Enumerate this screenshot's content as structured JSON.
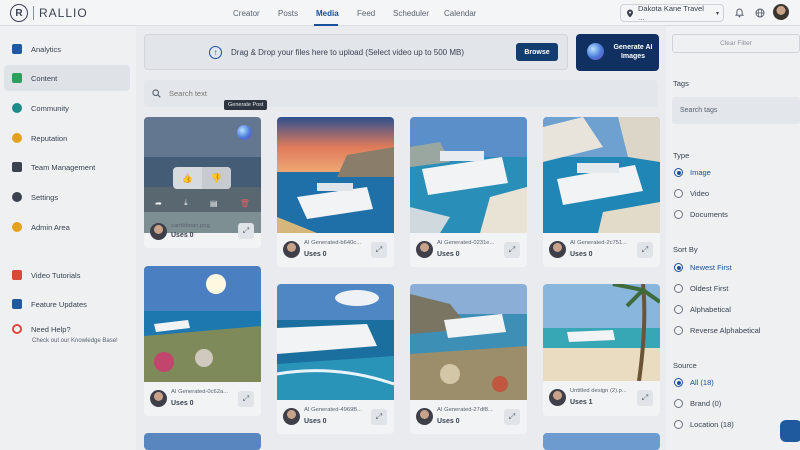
{
  "app": {
    "brand": "RALLIO",
    "brand_mark": "R"
  },
  "nav": {
    "items": [
      "Creator",
      "Posts",
      "Media",
      "Feed",
      "Scheduler",
      "Calendar"
    ],
    "active": "Media"
  },
  "location": {
    "label": "Dakota Kane Travel ..."
  },
  "sidebar": {
    "items": [
      {
        "label": "Analytics",
        "color": "#1f5a9e"
      },
      {
        "label": "Content",
        "color": "#2e9e5b"
      },
      {
        "label": "Community",
        "color": "#1f8a8a"
      },
      {
        "label": "Reputation",
        "color": "#e3a21a"
      },
      {
        "label": "Team Management",
        "color": "#3a4250"
      },
      {
        "label": "Settings",
        "color": "#3a4250"
      },
      {
        "label": "Admin Area",
        "color": "#e3a21a"
      },
      {
        "label": "Video Tutorials",
        "color": "#d9473d"
      },
      {
        "label": "Feature Updates",
        "color": "#1f5a9e"
      },
      {
        "label": "Need Help?",
        "color": "#d9473d"
      }
    ],
    "help_sub": "Check out our Knowledge Base!"
  },
  "upload": {
    "text": "Drag & Drop your files here to upload (Select video up to 500 MB)",
    "browse": "Browse"
  },
  "generate_ai": {
    "label": "Generate AI Images"
  },
  "search": {
    "placeholder": "Search text"
  },
  "tooltip": "Generate Post",
  "cards": [
    {
      "caption": "carribbean.png",
      "uses": "Uses 0"
    },
    {
      "caption": "AI Generated-b640c...",
      "uses": "Uses 0"
    },
    {
      "caption": "AI Generated-0231e...",
      "uses": "Uses 0"
    },
    {
      "caption": "AI Generated-2c751...",
      "uses": "Uses 0"
    },
    {
      "caption": "AI Generated-0c62a...",
      "uses": "Uses 0"
    },
    {
      "caption": "AI Generated-4969B...",
      "uses": "Uses 0"
    },
    {
      "caption": "AI Generated-27df8...",
      "uses": "Uses 0"
    },
    {
      "caption": "Untitled design (2).p...",
      "uses": "Uses 1"
    }
  ],
  "filter": {
    "clear": "Clear Filter",
    "tags_heading": "Tags",
    "tags_placeholder": "Search tags",
    "type_heading": "Type",
    "type_options": [
      "Image",
      "Video",
      "Documents"
    ],
    "type_selected": "Image",
    "sort_heading": "Sort By",
    "sort_options": [
      "Newest First",
      "Oldest First",
      "Alphabetical",
      "Reverse Alphabetical"
    ],
    "sort_selected": "Newest First",
    "source_heading": "Source",
    "source_options": [
      "All (18)",
      "Brand (0)",
      "Location (18)"
    ],
    "source_selected": "All (18)"
  },
  "icons": {
    "upload": "upload-icon",
    "search": "search-icon",
    "location": "location-pin-icon",
    "bell": "bell-icon",
    "globe": "globe-icon"
  }
}
